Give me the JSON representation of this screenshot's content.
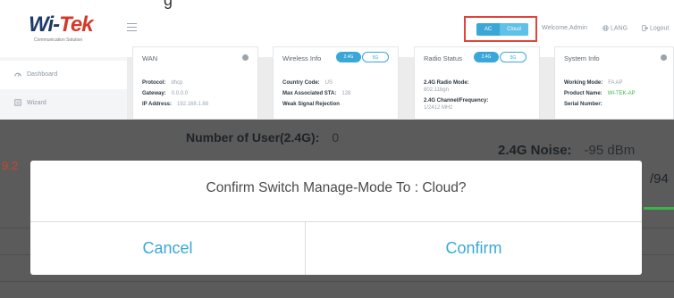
{
  "header": {
    "logo": {
      "main_left": "Wi-",
      "main_right": "Tek",
      "subtitle": "Communication Solution"
    },
    "fragment_text": "g",
    "mode_switch": {
      "ac_label": "AC",
      "cloud_label": "Cloud"
    },
    "welcome_text": "Welcome,Admin",
    "lang_label": "LANG",
    "logout_label": "Logout"
  },
  "sidebar": {
    "items": [
      {
        "label": "Dashboard",
        "icon": "dashboard-icon",
        "active": true
      },
      {
        "label": "Wizard",
        "icon": "wizard-icon",
        "active": false
      }
    ]
  },
  "cards": {
    "wan": {
      "title": "WAN",
      "rows": [
        {
          "label": "Protocol:",
          "value": "dhcp"
        },
        {
          "label": "Gateway:",
          "value": "0.0.0.0"
        },
        {
          "label": "IP Address:",
          "value": "192.168.1.88"
        }
      ]
    },
    "wireless": {
      "title": "Wireless Info",
      "pill_on": "2.4G",
      "pill_off": "5G",
      "rows": [
        {
          "label": "Country Code:",
          "value": "US"
        },
        {
          "label": "Max Associated STA:",
          "value": "128"
        },
        {
          "label": "Weak Signal Rejection",
          "value": ""
        }
      ]
    },
    "radio": {
      "title": "Radio Status",
      "pill_on": "2.4G",
      "pill_off": "5G",
      "rows": [
        {
          "label": "2.4G Radio Mode:",
          "value": ""
        },
        {
          "label": "",
          "value": "802.11bgn"
        },
        {
          "label": "2.4G Channel/Frequency:",
          "value": ""
        },
        {
          "label": "",
          "value": "1/2412 MHz"
        }
      ]
    },
    "system": {
      "title": "System Info",
      "rows": [
        {
          "label": "Working Mode:",
          "value": "FA AP"
        },
        {
          "label": "Product Name:",
          "value": "WI-TEK-AP"
        },
        {
          "label": "Serial Number:",
          "value": ""
        }
      ]
    }
  },
  "background": {
    "users_label": "Number of User(2.4G):",
    "users_value": "0",
    "noise_label": "2.4G Noise:",
    "noise_value": "-95 dBm",
    "left_number": "9.2",
    "right_fraction": "/94"
  },
  "dialog": {
    "message": "Confirm Switch Manage-Mode To : Cloud?",
    "cancel_label": "Cancel",
    "confirm_label": "Confirm"
  },
  "colors": {
    "accent": "#3aa7d8",
    "highlight_border": "#e0443c",
    "overlay": "#5b5b5b",
    "success": "#3bb54a"
  }
}
